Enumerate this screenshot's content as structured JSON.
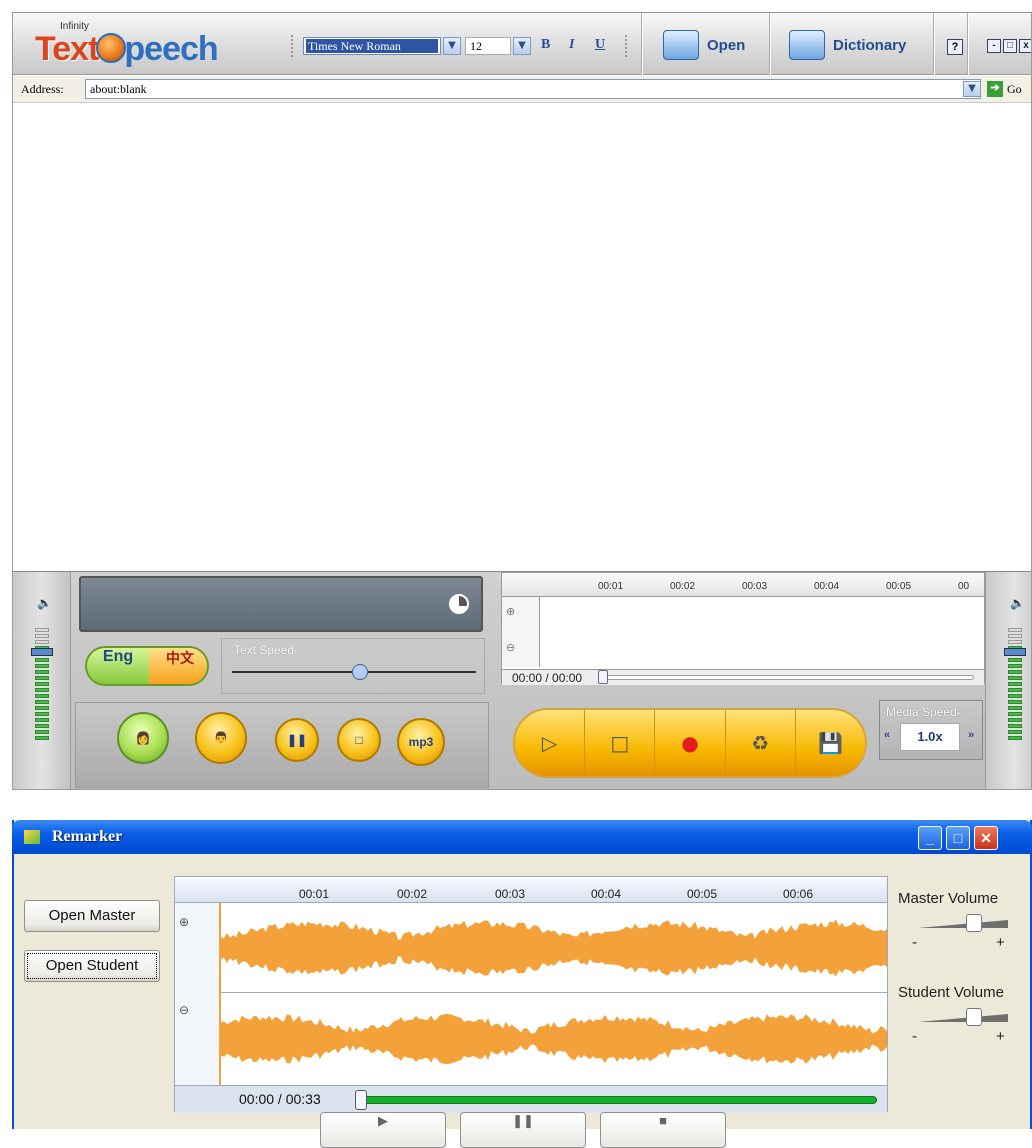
{
  "tts": {
    "logo_small": "Infinity",
    "logo_text": "Text",
    "logo_text2": "peech",
    "font_name": "Times New Roman",
    "font_size": "12",
    "bold": "B",
    "italic": "I",
    "underline": "U",
    "open_label": "Open",
    "dictionary_label": "Dictionary",
    "help_label": "?",
    "address_label": "Address:",
    "address_value": "about:blank",
    "go_label": "Go",
    "lang_eng": "Eng",
    "lang_zh": "中文",
    "text_speed_label": "-Text Speed-",
    "mp3_label": "mp3",
    "ruler_ticks": [
      "00:01",
      "00:02",
      "00:03",
      "00:04",
      "00:05",
      "00"
    ],
    "time": "00:00 / 00:00",
    "media_speed_label": "-Media Speed-",
    "media_speed_value": "1.0x"
  },
  "remarker": {
    "title": "Remarker",
    "open_master": "Open Master",
    "open_student": "Open Student",
    "ruler_ticks": [
      "00:01",
      "00:02",
      "00:03",
      "00:04",
      "00:05",
      "00:06"
    ],
    "time": "00:00 / 00:33",
    "master_volume": "Master Volume",
    "student_volume": "Student Volume",
    "minus": "-",
    "plus": "+"
  },
  "colors": {
    "waveform": "#f3a23b",
    "progress": "#1aae2e",
    "xp_title": "#0a5ee6"
  }
}
